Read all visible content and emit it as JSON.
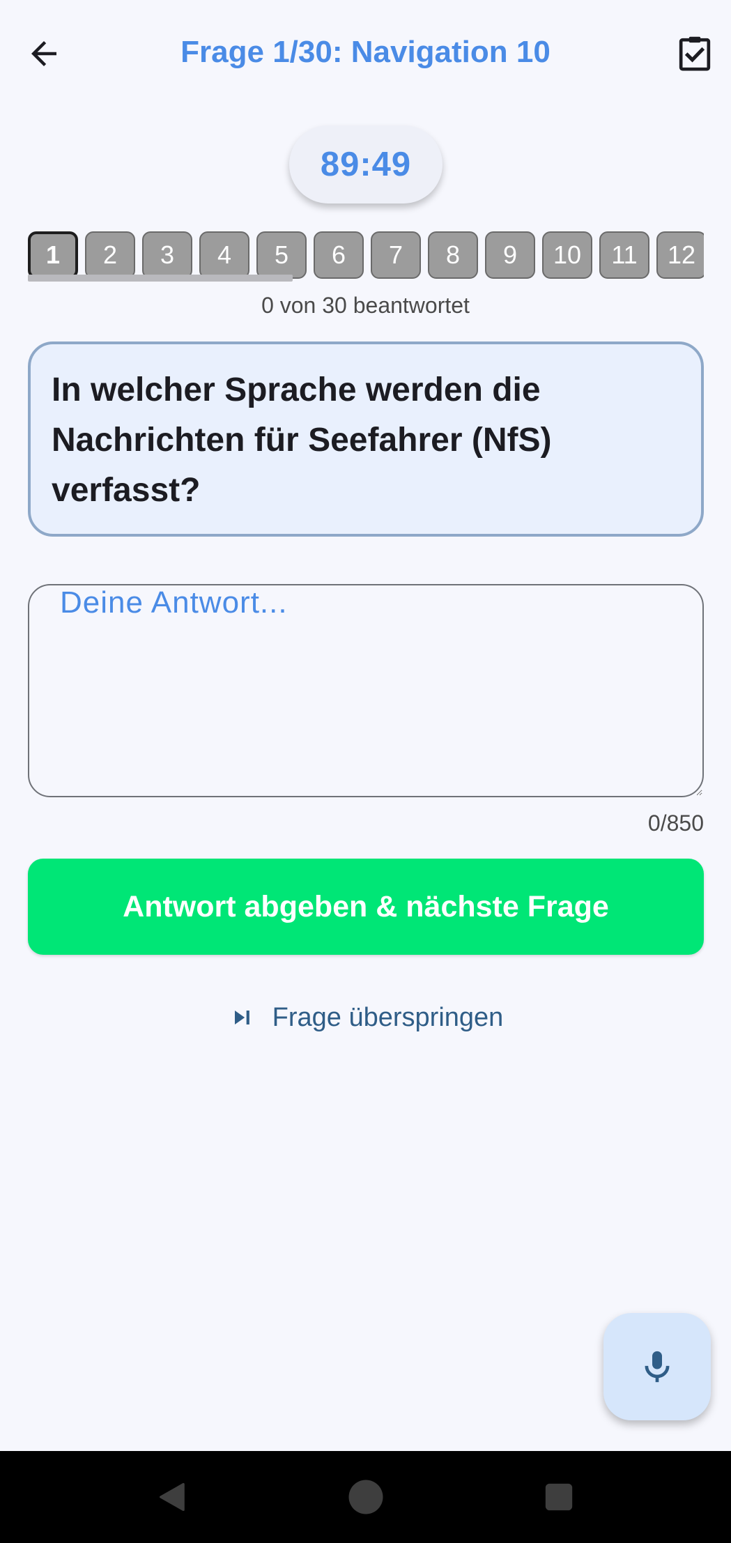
{
  "app_bar": {
    "title": "Frage 1/30: Navigation 10",
    "back_icon": "arrow-left-icon",
    "finish_icon": "clipboard-check-icon"
  },
  "timer": {
    "value": "89:49"
  },
  "question_nav": {
    "items": [
      "1",
      "2",
      "3",
      "4",
      "5",
      "6",
      "7",
      "8",
      "9",
      "10",
      "11",
      "12"
    ],
    "current": "1"
  },
  "progress": {
    "text": "0 von 30 beantwortet"
  },
  "question": {
    "text": "In welcher Sprache werden die Nachrichten für Seefahrer (NfS) verfasst?"
  },
  "answer": {
    "value": "",
    "placeholder": "Deine Antwort...",
    "counter": "0/850"
  },
  "actions": {
    "submit_label": "Antwort abgeben & nächste Frage",
    "skip_label": "Frage überspringen",
    "skip_icon": "skip-next-icon",
    "mic_icon": "microphone-icon"
  },
  "colors": {
    "accent": "#4A8BE6",
    "submit": "#00E676",
    "question_bg": "#E9F0FD",
    "background": "#F6F7FD"
  }
}
